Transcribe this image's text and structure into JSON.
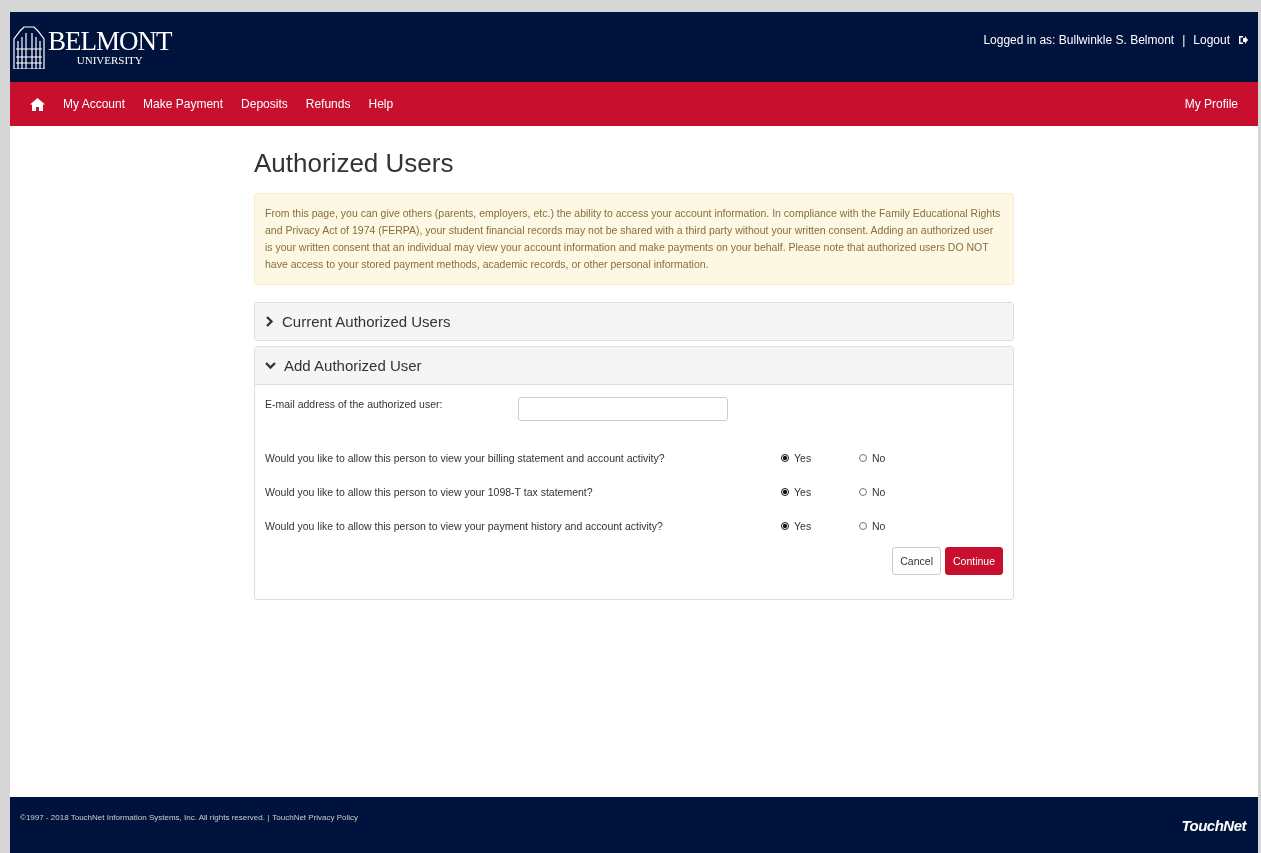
{
  "header": {
    "logo": {
      "name": "BELMONT",
      "sub": "UNIVERSITY"
    },
    "logged_in": "Logged in as: Bullwinkle S. Belmont",
    "separator": "|",
    "logout": "Logout"
  },
  "nav": {
    "items": [
      "My Account",
      "Make Payment",
      "Deposits",
      "Refunds",
      "Help"
    ],
    "profile": "My Profile"
  },
  "page": {
    "title": "Authorized Users",
    "notice": "From this page, you can give others (parents, employers, etc.) the ability to access your account information. In compliance with the Family Educational Rights and Privacy Act of 1974 (FERPA), your student financial records may not be shared with a third party without your written consent. Adding an authorized user is your written consent that an individual may view your account information and make payments on your behalf. Please note that authorized users DO NOT have access to your stored payment methods, academic records, or other personal information.",
    "panels": [
      {
        "title": "Current Authorized Users",
        "expanded": false
      },
      {
        "title": "Add Authorized User",
        "expanded": true
      }
    ],
    "form": {
      "email_label": "E-mail address of the authorized user:",
      "questions": [
        {
          "text": "Would you like to allow this person to view your billing statement and account activity?",
          "options": [
            {
              "label": "Yes",
              "selected": true
            },
            {
              "label": "No",
              "selected": false
            }
          ]
        },
        {
          "text": "Would you like to allow this person to view your 1098-T tax statement?",
          "options": [
            {
              "label": "Yes",
              "selected": true
            },
            {
              "label": "No",
              "selected": false
            }
          ]
        },
        {
          "text": "Would you like to allow this person to view your payment history and account activity?",
          "options": [
            {
              "label": "Yes",
              "selected": true
            },
            {
              "label": "No",
              "selected": false
            }
          ]
        }
      ],
      "buttons": [
        "Cancel",
        "Continue"
      ]
    }
  },
  "footer": {
    "copyright": "©1997 - 2018  TouchNet Information Systems, Inc. All rights reserved. |",
    "privacy": "TouchNet Privacy Policy",
    "logo": "TouchNet"
  }
}
